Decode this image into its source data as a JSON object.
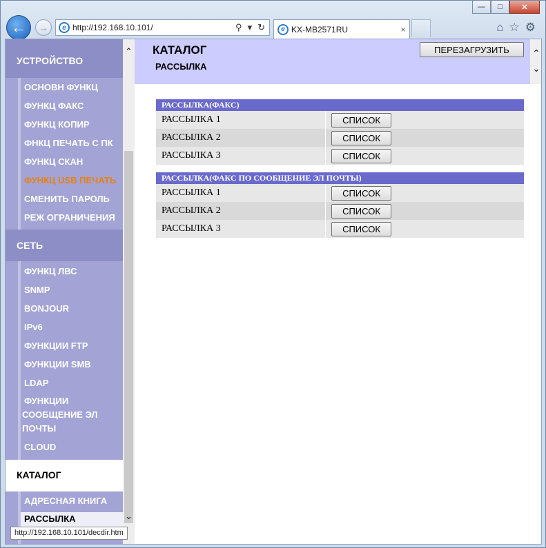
{
  "browser": {
    "address_url": "http://192.168.10.101/",
    "tab_title": "KX-MB2571RU",
    "tab_close": "×",
    "status_url": "http://192.168.10.101/decdir.htm"
  },
  "sidebar": {
    "sections": [
      {
        "title": "УСТРОЙСТВО",
        "items": [
          "ОСНОВН ФУНКЦ",
          "ФУНКЦ ФАКС",
          "ФУНКЦ КОПИР",
          "ФНКЦ ПЕЧАТЬ С ПК",
          "ФУНКЦ СКАН",
          "ФУНКЦ USB ПЕЧАТЬ",
          "СМЕНИТЬ ПАРОЛЬ",
          "РЕЖ ОГРАНИЧЕНИЯ"
        ]
      },
      {
        "title": "СЕТЬ",
        "items": [
          "ФУНКЦ ЛВС",
          "SNMP",
          "BONJOUR",
          "IPv6",
          "ФУНКЦИИ FTP",
          "ФУНКЦИИ SMB",
          "LDAP",
          "ФУНКЦИИ",
          "СООБЩЕНИЕ ЭЛ",
          "ПОЧТЫ",
          "CLOUD"
        ]
      },
      {
        "title": "КАТАЛОГ",
        "items": [
          "АДРЕСНАЯ КНИГА",
          "РАССЫЛКА"
        ]
      }
    ]
  },
  "header": {
    "title": "КАТАЛОГ",
    "subtitle": "РАССЫЛКА",
    "reload_label": "ПЕРЕЗАГРУЗИТЬ"
  },
  "tables": [
    {
      "title": "РАССЫЛКА(ФАКС)",
      "rows": [
        {
          "label": "РАССЫЛКА 1",
          "button": "СПИСОК"
        },
        {
          "label": "РАССЫЛКА 2",
          "button": "СПИСОК"
        },
        {
          "label": "РАССЫЛКА 3",
          "button": "СПИСОК"
        }
      ]
    },
    {
      "title": "РАССЫЛКА(ФАКС ПО СООБЩЕНИЕ ЭЛ ПОЧТЫ)",
      "rows": [
        {
          "label": "РАССЫЛКА 1",
          "button": "СПИСОК"
        },
        {
          "label": "РАССЫЛКА 2",
          "button": "СПИСОК"
        },
        {
          "label": "РАССЫЛКА 3",
          "button": "СПИСОК"
        }
      ]
    }
  ],
  "colors": {
    "sidebar_bg": "#a3a3d5",
    "section_head_bg": "#8e8ec7",
    "header_band": "#ccccff",
    "table_head": "#6a6acc",
    "active_item": "#e8810f"
  }
}
